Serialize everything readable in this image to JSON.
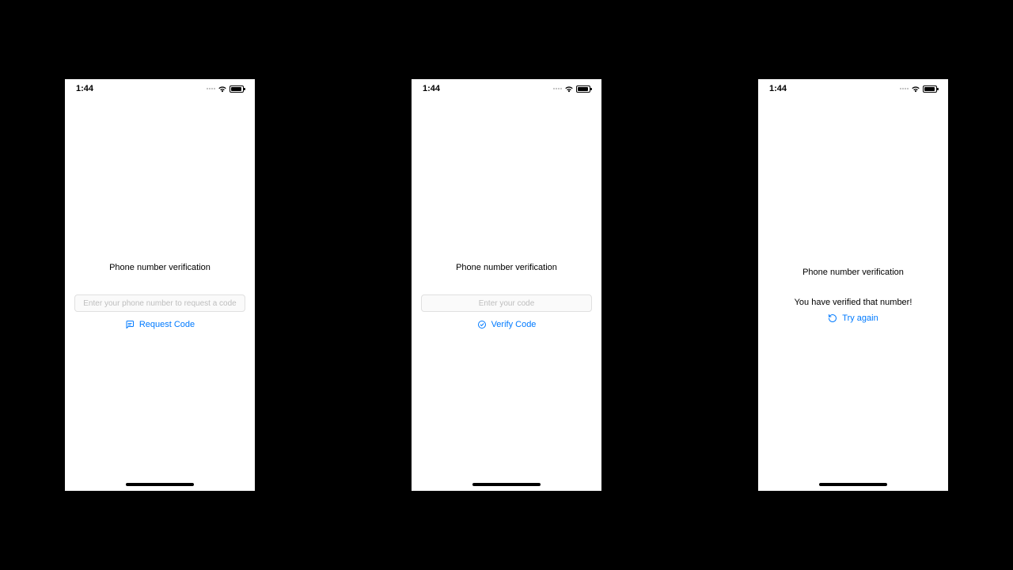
{
  "status": {
    "time": "1:44"
  },
  "common": {
    "title": "Phone number verification"
  },
  "screen1": {
    "input_placeholder": "Enter your phone number to request a code",
    "button_label": "Request Code"
  },
  "screen2": {
    "input_placeholder": "Enter your code",
    "button_label": "Verify Code"
  },
  "screen3": {
    "message": "You have verified that number!",
    "button_label": "Try again"
  }
}
